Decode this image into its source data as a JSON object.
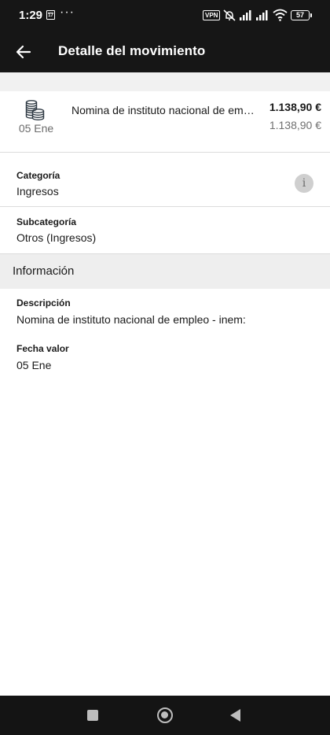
{
  "status_bar": {
    "time": "1:29",
    "calendar_day": "17",
    "more_indicator": "···",
    "vpn_label": "VPN",
    "battery_level": "57",
    "icons": [
      "calendar-icon",
      "vpn-icon",
      "mute-icon",
      "signal-icon",
      "signal-icon",
      "wifi-icon",
      "battery-icon"
    ]
  },
  "header": {
    "title": "Detalle del movimiento",
    "back_icon": "arrow-left-icon"
  },
  "transaction": {
    "icon": "coins-icon",
    "date": "05 Ene",
    "description": "Nomina de instituto nacional de empleo - inem:",
    "amount": "1.138,90 €",
    "balance": "1.138,90 €"
  },
  "category": {
    "label": "Categoría",
    "value": "Ingresos",
    "info_icon": "info-icon",
    "info_glyph": "i"
  },
  "subcategory": {
    "label": "Subcategoría",
    "value": "Otros (Ingresos)"
  },
  "information_section": {
    "title": "Información",
    "description_label": "Descripción",
    "description_value": "Nomina de instituto nacional de empleo - inem:",
    "date_label": "Fecha valor",
    "date_value": "05 Ene"
  },
  "nav_bar": {
    "icons": [
      "recents-icon",
      "home-icon",
      "back-icon"
    ]
  },
  "colors": {
    "app_bar": "#161616",
    "background": "#ffffff",
    "section_background": "#eeeeee",
    "muted_text": "#707070"
  }
}
